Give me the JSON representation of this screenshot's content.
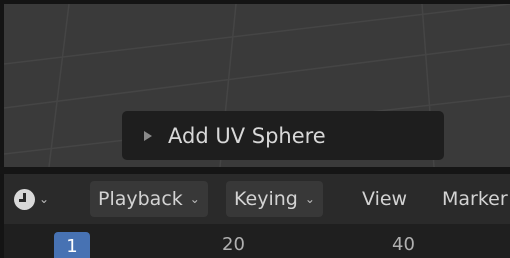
{
  "viewport": {
    "last_operator": {
      "label": "Add UV Sphere"
    }
  },
  "timeline": {
    "editor_type_icon": "clock-icon",
    "menus": {
      "playback": "Playback",
      "keying": "Keying",
      "view": "View",
      "marker": "Marker"
    },
    "current_frame": "1",
    "ruler_ticks": [
      "20",
      "40"
    ]
  },
  "colors": {
    "viewport_bg": "#3a3a3a",
    "header_bg": "#2a2a2a",
    "current_frame_accent": "#4772b3"
  }
}
